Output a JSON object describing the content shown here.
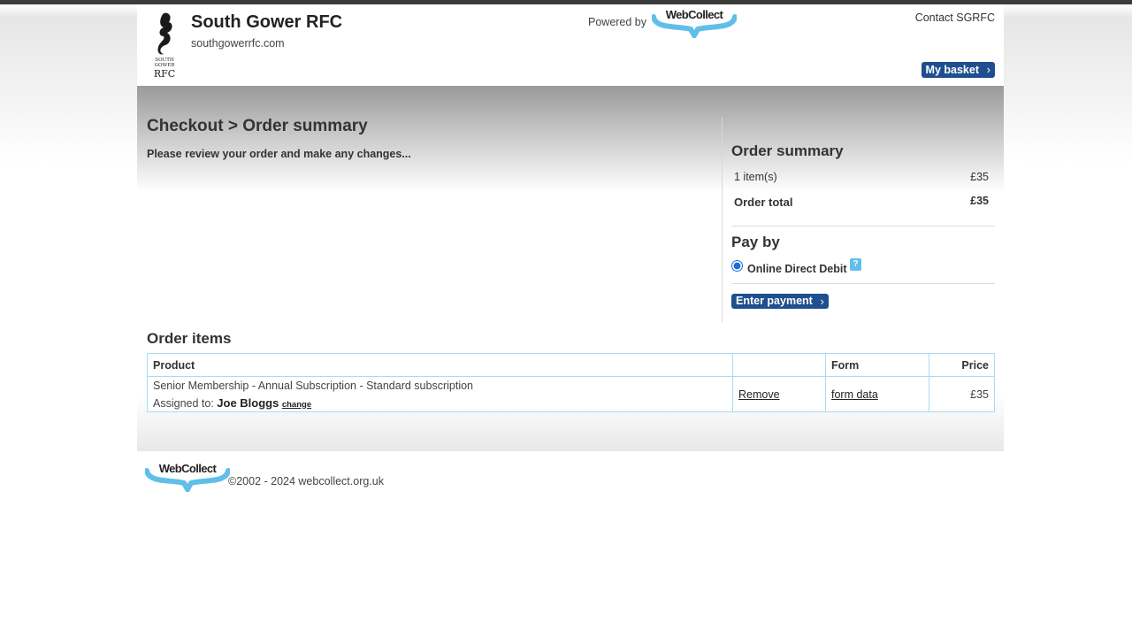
{
  "header": {
    "club_name": "South Gower RFC",
    "club_url": "southgowerrfc.com",
    "crest_text": [
      "SOUTH",
      "GOWER",
      "RFC"
    ],
    "powered_by": "Powered by",
    "webcollect_logo_text": "WebCollect",
    "contact": "Contact SGRFC",
    "basket_label": "My basket"
  },
  "main": {
    "title": "Checkout > Order summary",
    "subtitle": "Please review your order and make any changes..."
  },
  "summary": {
    "title": "Order summary",
    "items_label": "1 item(s)",
    "items_value": "£35",
    "total_label": "Order total",
    "total_value": "£35"
  },
  "pay": {
    "title": "Pay by",
    "option_label": "Online Direct Debit",
    "help_icon": "?",
    "button_label": "Enter payment"
  },
  "order_items": {
    "title": "Order items",
    "columns": [
      "Product",
      "",
      "Form",
      "Price"
    ],
    "rows": [
      {
        "product": "Senior Membership - Annual Subscription - Standard subscription",
        "assigned_prefix": "Assigned to:",
        "assigned_name": "Joe Bloggs",
        "change_label": "change",
        "remove_label": "Remove",
        "form_label": "form data",
        "price": "£35"
      }
    ]
  },
  "footer": {
    "logo_text": "WebCollect",
    "copyright": "©2002 - 2024 webcollect.org.uk"
  },
  "colors": {
    "accent_button": "#1f4f8f",
    "table_border": "#a8dcef",
    "logo_blue": "#5fbfe8"
  }
}
